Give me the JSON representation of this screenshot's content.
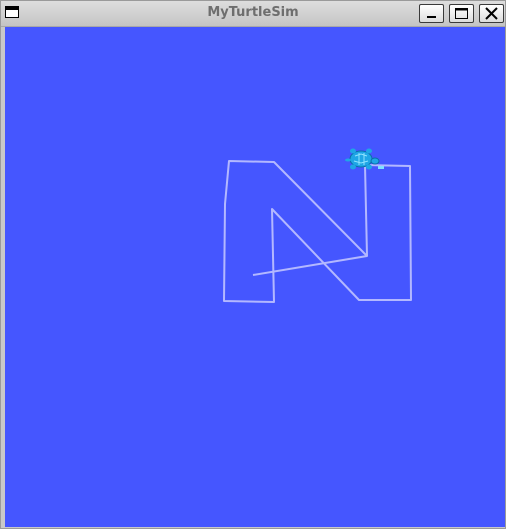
{
  "window": {
    "title": "MyTurtleSim"
  },
  "colors": {
    "canvas_background": "#4556ff",
    "pen": "#b3b8ff",
    "turtle": "#1fa6e6"
  },
  "icons": {
    "window_menu": "window-menu-icon",
    "minimize": "minimize-icon",
    "maximize": "maximize-icon",
    "close": "close-icon",
    "turtle": "turtle-icon"
  }
}
